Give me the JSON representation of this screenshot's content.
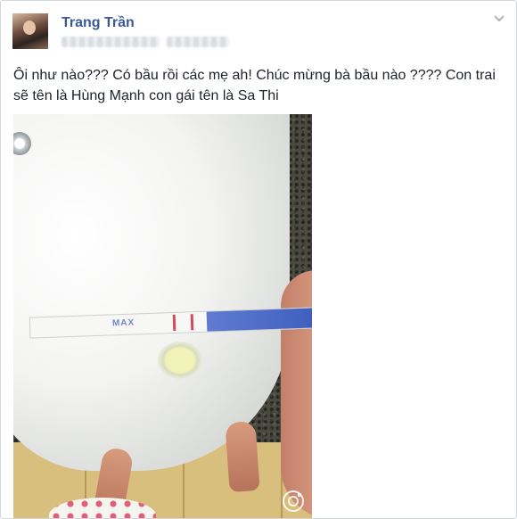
{
  "post": {
    "author": "Trang Trần",
    "text": "Ôi như nào??? Có bầu rồi các mẹ ah! Chúc mừng bà bầu nào ???? Con trai sẽ tên là Hùng Mạnh con gái tên là Sa Thi",
    "photo_caption_marks": {
      "strip_label": "MAX"
    }
  },
  "icons": {
    "options": "chevron-down-icon",
    "watermark": "camera-watermark-icon"
  },
  "colors": {
    "author_link": "#3b5998",
    "text": "#1d2129",
    "border": "#d3d6db"
  }
}
